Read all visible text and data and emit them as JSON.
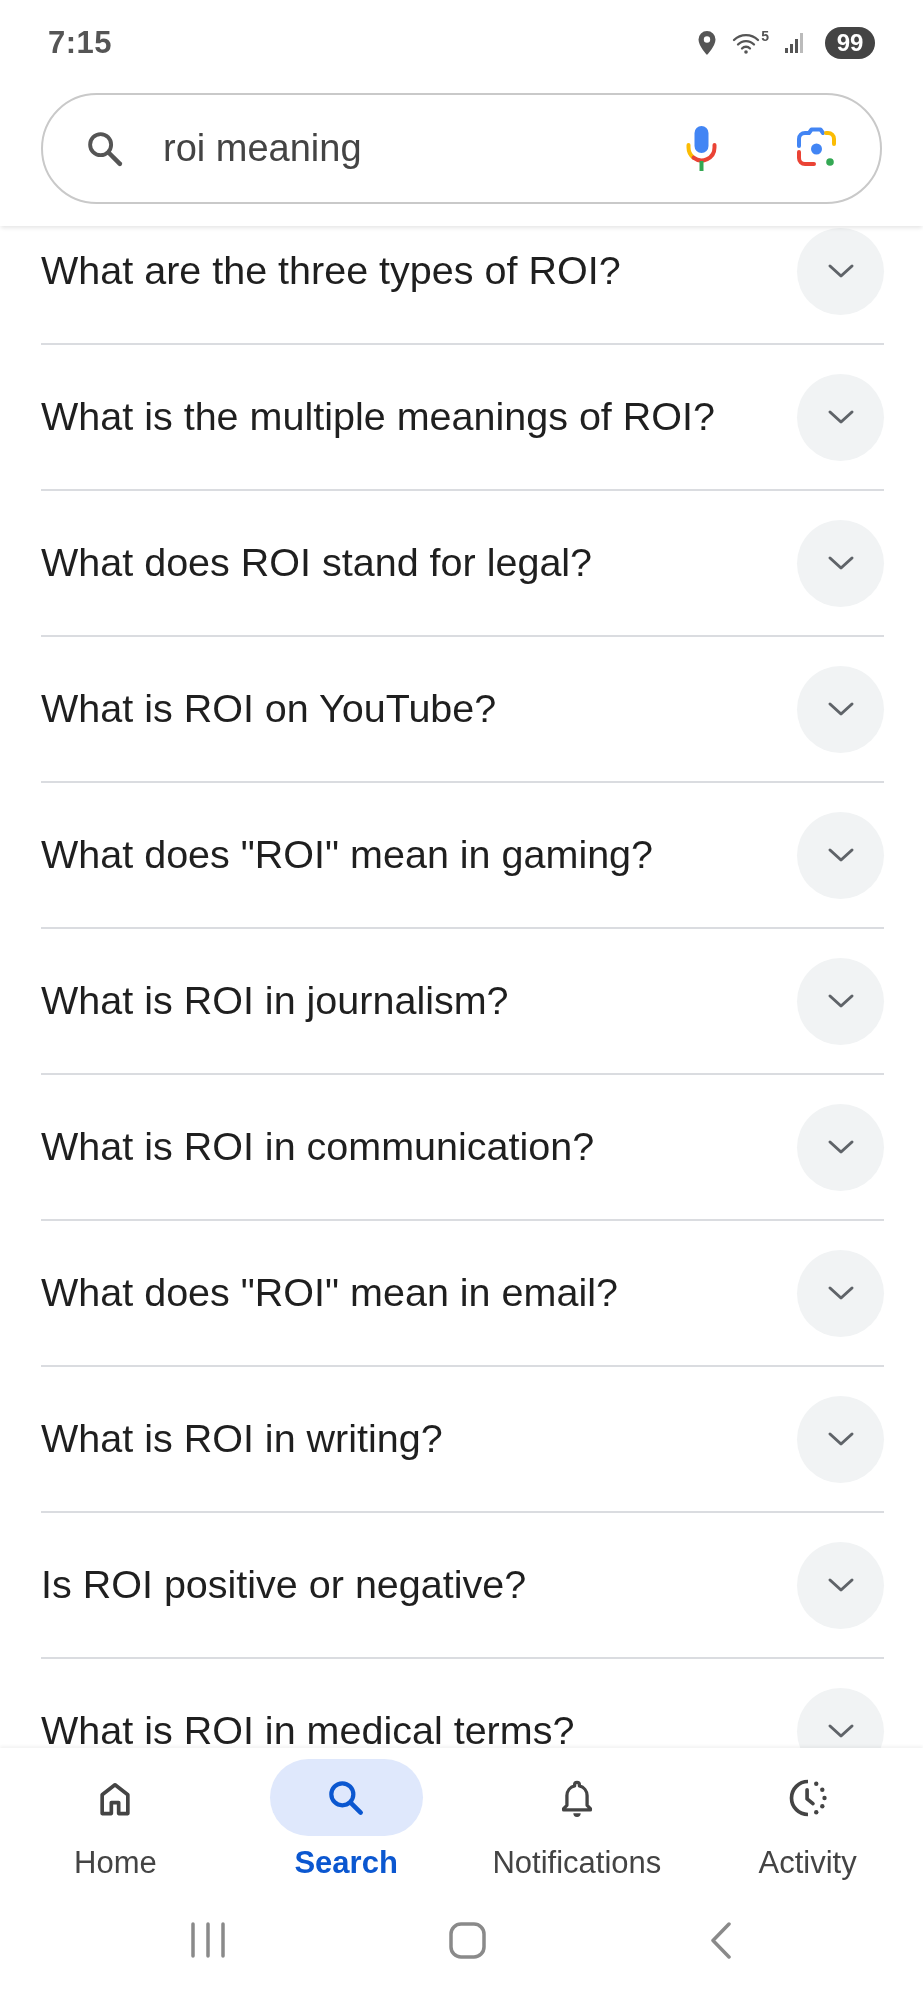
{
  "status_bar": {
    "time": "7:15",
    "wifi_band": "5",
    "battery": "99"
  },
  "search": {
    "value": "roi meaning"
  },
  "questions": [
    {
      "text": "What are the three types of ROI?",
      "expanded": false
    },
    {
      "text": "What is the multiple meanings of ROI?",
      "expanded": false
    },
    {
      "text": "What does ROI stand for legal?",
      "expanded": false
    },
    {
      "text": "What is ROI on YouTube?",
      "expanded": false
    },
    {
      "text": "What does \"ROI\" mean in gaming?",
      "expanded": false
    },
    {
      "text": "What is ROI in journalism?",
      "expanded": false
    },
    {
      "text": "What is ROI in communication?",
      "expanded": false
    },
    {
      "text": "What does \"ROI\" mean in email?",
      "expanded": false
    },
    {
      "text": "What is ROI in writing?",
      "expanded": false
    },
    {
      "text": "Is ROI positive or negative?",
      "expanded": false
    },
    {
      "text": "What is ROI in medical terms?",
      "expanded": false
    }
  ],
  "bottom_nav": [
    {
      "label": "Home",
      "selected": false
    },
    {
      "label": "Search",
      "selected": true
    },
    {
      "label": "Notifications",
      "selected": false
    },
    {
      "label": "Activity",
      "selected": false
    }
  ]
}
